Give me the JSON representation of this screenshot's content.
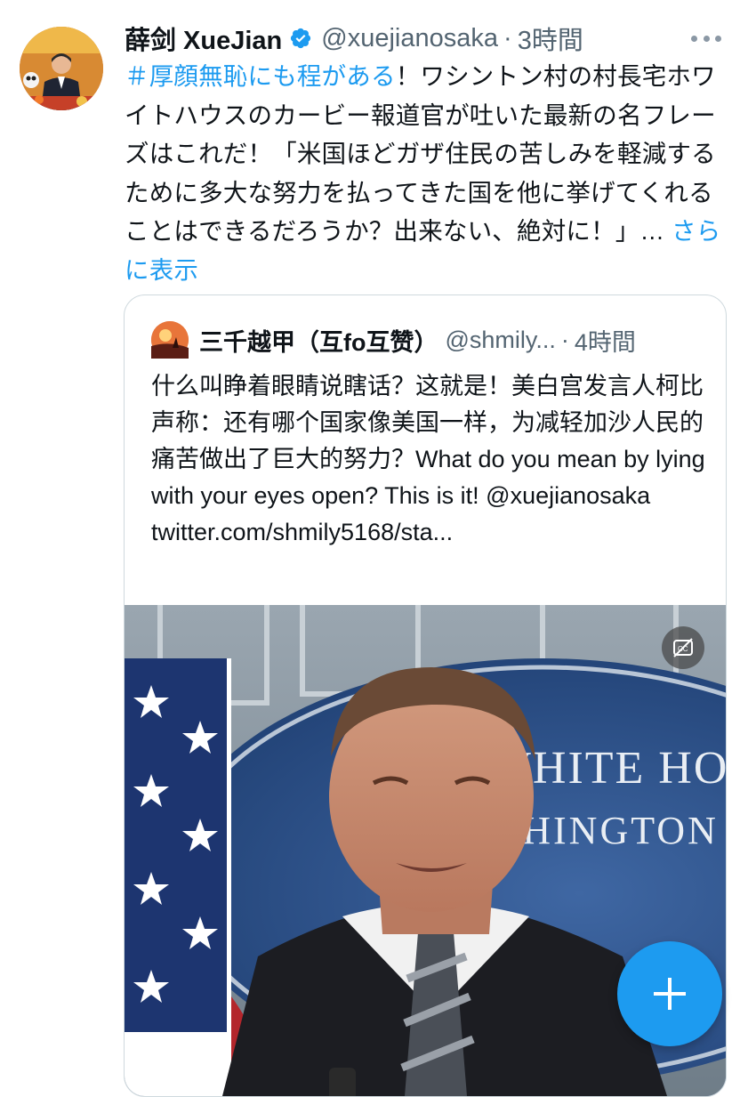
{
  "tweet": {
    "author": {
      "display_name": "薛剑 XueJian",
      "handle": "@xuejianosaka",
      "verified": true
    },
    "separator": "·",
    "time": "3時間",
    "hashtag": "＃厚顔無恥にも程がある",
    "body": "！ワシントン村の村長宅ホワイトハウスのカービー報道官が吐いた最新の名フレーズはこれだ！「米国ほどガザ住民の苦しみを軽減するために多大な努力を払ってきた国を他に挙げてくれることはできるだろうか？出来ない、絶対に！」…",
    "show_more": "さらに表示"
  },
  "quote": {
    "author": {
      "display_name": "三千越甲（互fo互赞）",
      "handle": "@shmily...",
      "time": "4時間"
    },
    "separator": "·",
    "text": "什么叫睁着眼睛说瞎话？这就是！美白宫发言人柯比声称：还有哪个国家像美国一样，为减轻加沙人民的痛苦做出了巨大的努力？What do you mean by lying with your eyes open? This is it! @xuejianosaka",
    "link": "twitter.com/shmily5168/sta...",
    "video": {
      "backdrop_text_line1": "E WHITE HO",
      "backdrop_text_line2": "ASHINGTON",
      "captions_icon": "captions-off-icon"
    }
  },
  "fab": {
    "icon": "plus-icon",
    "color": "#1d9bf0"
  },
  "colors": {
    "accent": "#1d9bf0",
    "secondary_text": "#536471",
    "primary_text": "#0f1419",
    "border": "#cfd9de"
  }
}
